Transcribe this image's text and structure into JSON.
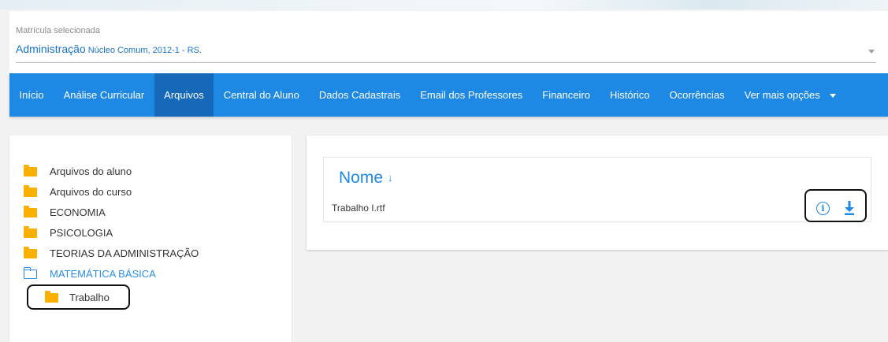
{
  "enrollment": {
    "label": "Matrícula selecionada",
    "course": "Administração",
    "details": "Núcleo Comum, 2012-1 - RS."
  },
  "nav": {
    "items": [
      {
        "label": "Início",
        "active": false
      },
      {
        "label": "Análise Curricular",
        "active": false
      },
      {
        "label": "Arquivos",
        "active": true
      },
      {
        "label": "Central do Aluno",
        "active": false
      },
      {
        "label": "Dados Cadastrais",
        "active": false
      },
      {
        "label": "Email dos Professores",
        "active": false
      },
      {
        "label": "Financeiro",
        "active": false
      },
      {
        "label": "Histórico",
        "active": false
      },
      {
        "label": "Ocorrências",
        "active": false
      }
    ],
    "more_label": "Ver mais opções"
  },
  "folders": {
    "items": [
      {
        "label": "Arquivos do aluno",
        "open": false
      },
      {
        "label": "Arquivos do curso",
        "open": false
      },
      {
        "label": "ECONOMIA",
        "open": false
      },
      {
        "label": "PSICOLOGIA",
        "open": false
      },
      {
        "label": "TEORIAS DA ADMINISTRAÇÃO",
        "open": false
      },
      {
        "label": "MATEMÁTICA BÁSICA",
        "open": true
      }
    ],
    "subfolder": {
      "label": "Trabalho"
    }
  },
  "files": {
    "column_header": "Nome",
    "sort_glyph": "↓",
    "rows": [
      {
        "name": "Trabalho I.rtf"
      }
    ]
  },
  "colors": {
    "primary": "#1e88e5",
    "active_tab": "#1669b9",
    "folder": "#f9b000",
    "selected_text": "#2a8ee5"
  }
}
